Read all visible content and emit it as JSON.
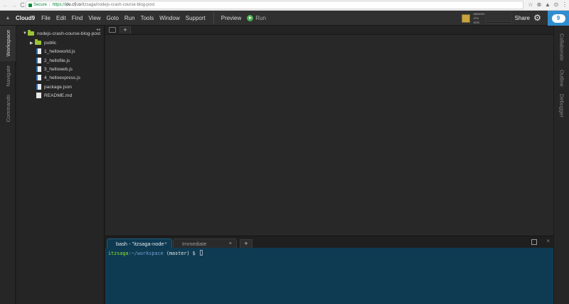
{
  "browser": {
    "back": "←",
    "forward": "→",
    "reload": "C",
    "home": "⌂",
    "secure_label": "Secure",
    "url_scheme": "https://",
    "url_host": "ide.c9.io",
    "url_path": "/itzsaga/nodejs-crash-course-blog-post",
    "right_icons": [
      "☆",
      "⊗",
      "▲",
      "⊙",
      "⋮"
    ]
  },
  "menubar": {
    "collapse": "▲",
    "brand": "Cloud9",
    "items": [
      "File",
      "Edit",
      "Find",
      "View",
      "Goto",
      "Run",
      "Tools",
      "Window",
      "Support"
    ],
    "preview": "Preview",
    "run": "Run",
    "monitor": [
      "MEMORY",
      "CPU",
      "DISK"
    ],
    "share": "Share",
    "logo_glyph": "9"
  },
  "left_tabs": [
    "Workspace",
    "Navigate",
    "Commands"
  ],
  "right_tabs": [
    "Collaborate",
    "Outline",
    "Debugger"
  ],
  "tree": {
    "collapse": "◂◂",
    "root": "nodejs-crash-course-blog-post",
    "items": [
      {
        "name": "public",
        "kind": "folder"
      },
      {
        "name": "1_helloworld.js",
        "kind": "js"
      },
      {
        "name": "2_hellofile.js",
        "kind": "js"
      },
      {
        "name": "3_helloweb.js",
        "kind": "js"
      },
      {
        "name": "4_helloexpress.js",
        "kind": "js"
      },
      {
        "name": "package.json",
        "kind": "json"
      },
      {
        "name": "README.md",
        "kind": "md"
      }
    ]
  },
  "editor": {
    "add_tab": "+"
  },
  "terminal": {
    "tabs": [
      {
        "label": "bash - \"itzsaga-node",
        "close": "×"
      },
      {
        "label": "Immediate",
        "close": "×"
      }
    ],
    "add_tab": "+",
    "panel_close": "×",
    "prompt_user": "itzsaga",
    "prompt_path": ":~/workspace",
    "prompt_rest": " (master) $ "
  },
  "colors": {
    "accent": "#2f8ecf",
    "terminal_bg": "#0f3b52",
    "folder": "#9cc534",
    "run": "#4caf50"
  }
}
